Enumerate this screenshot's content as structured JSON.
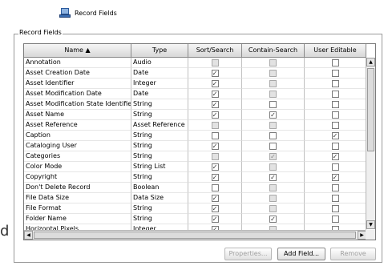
{
  "tab": {
    "label": "Record Fields"
  },
  "group": {
    "label": "Record Fields"
  },
  "table": {
    "columns": [
      "Name ▲",
      "Type",
      "Sort/Search",
      "Contain-Search",
      "User Editable"
    ],
    "rows": [
      {
        "name": "Annotation",
        "type": "Audio",
        "sort": [
          true,
          false
        ],
        "contain": [
          true,
          false
        ],
        "edit": [
          false,
          false
        ]
      },
      {
        "name": "Asset Creation Date",
        "type": "Date",
        "sort": [
          false,
          true
        ],
        "contain": [
          true,
          false
        ],
        "edit": [
          false,
          false
        ]
      },
      {
        "name": "Asset Identifier",
        "type": "Integer",
        "sort": [
          false,
          true
        ],
        "contain": [
          true,
          false
        ],
        "edit": [
          false,
          false
        ]
      },
      {
        "name": "Asset Modification Date",
        "type": "Date",
        "sort": [
          false,
          true
        ],
        "contain": [
          true,
          false
        ],
        "edit": [
          false,
          false
        ]
      },
      {
        "name": "Asset Modification State Identifier",
        "type": "String",
        "sort": [
          false,
          true
        ],
        "contain": [
          false,
          false
        ],
        "edit": [
          false,
          false
        ]
      },
      {
        "name": "Asset Name",
        "type": "String",
        "sort": [
          false,
          true
        ],
        "contain": [
          false,
          true
        ],
        "edit": [
          false,
          false
        ]
      },
      {
        "name": "Asset Reference",
        "type": "Asset Reference",
        "sort": [
          true,
          false
        ],
        "contain": [
          true,
          false
        ],
        "edit": [
          false,
          false
        ]
      },
      {
        "name": "Caption",
        "type": "String",
        "sort": [
          false,
          false
        ],
        "contain": [
          false,
          false
        ],
        "edit": [
          false,
          true
        ]
      },
      {
        "name": "Cataloging User",
        "type": "String",
        "sort": [
          false,
          true
        ],
        "contain": [
          false,
          false
        ],
        "edit": [
          false,
          false
        ]
      },
      {
        "name": "Categories",
        "type": "String",
        "sort": [
          true,
          false
        ],
        "contain": [
          true,
          true
        ],
        "edit": [
          false,
          true
        ]
      },
      {
        "name": "Color Mode",
        "type": "String List",
        "sort": [
          false,
          true
        ],
        "contain": [
          true,
          false
        ],
        "edit": [
          false,
          false
        ]
      },
      {
        "name": "Copyright",
        "type": "String",
        "sort": [
          false,
          true
        ],
        "contain": [
          false,
          true
        ],
        "edit": [
          false,
          true
        ]
      },
      {
        "name": "Don't Delete Record",
        "type": "Boolean",
        "sort": [
          false,
          false
        ],
        "contain": [
          true,
          false
        ],
        "edit": [
          false,
          false
        ]
      },
      {
        "name": "File Data Size",
        "type": "Data Size",
        "sort": [
          false,
          true
        ],
        "contain": [
          true,
          false
        ],
        "edit": [
          false,
          false
        ]
      },
      {
        "name": "File Format",
        "type": "String",
        "sort": [
          false,
          true
        ],
        "contain": [
          true,
          false
        ],
        "edit": [
          false,
          false
        ]
      },
      {
        "name": "Folder Name",
        "type": "String",
        "sort": [
          false,
          true
        ],
        "contain": [
          false,
          true
        ],
        "edit": [
          false,
          false
        ]
      },
      {
        "name": "Horizontal Pixels",
        "type": "Integer",
        "sort": [
          false,
          true
        ],
        "contain": [
          true,
          false
        ],
        "edit": [
          false,
          false
        ]
      }
    ]
  },
  "buttons": {
    "properties": "Properties...",
    "add_field": "Add Field...",
    "remove": "Remove"
  },
  "edge_text": "d",
  "colors": {
    "disabled_fill": "#e2e2e2",
    "header": "#d8d8d8"
  }
}
